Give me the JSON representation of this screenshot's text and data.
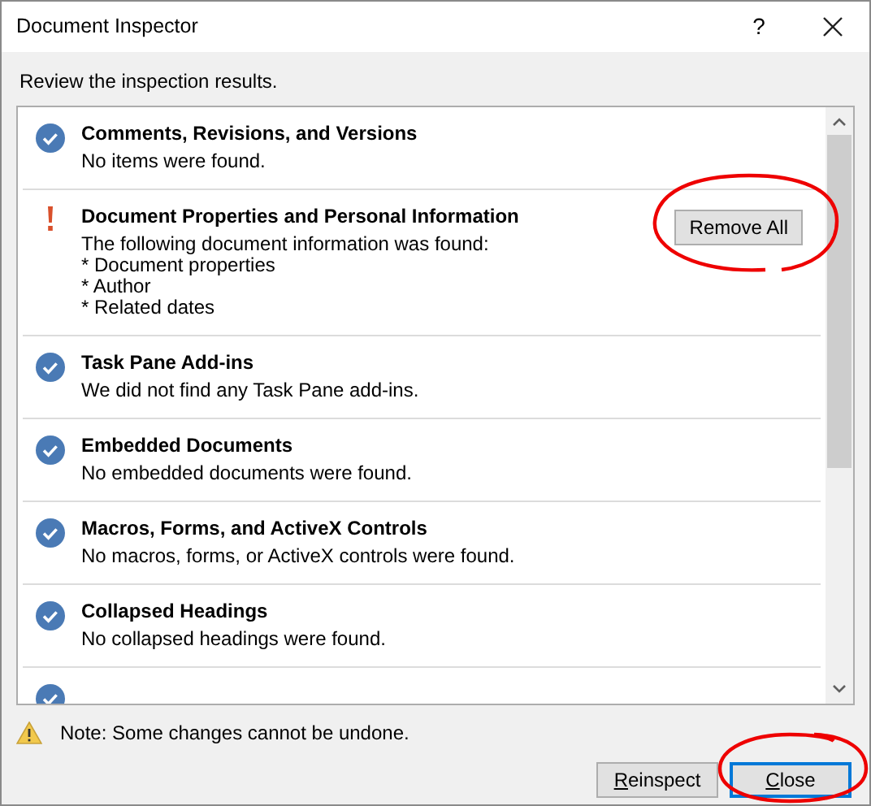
{
  "window": {
    "title": "Document Inspector",
    "help": "?"
  },
  "instruction": "Review the inspection results.",
  "results": [
    {
      "kind": "ok",
      "title": "Comments, Revisions, and Versions",
      "lines": [
        "No items were found."
      ]
    },
    {
      "kind": "warning",
      "title": "Document Properties and Personal Information",
      "lines": [
        "The following document information was found:",
        "* Document properties",
        "* Author",
        "* Related dates"
      ],
      "action": "Remove All"
    },
    {
      "kind": "ok",
      "title": "Task Pane Add-ins",
      "lines": [
        "We did not find any Task Pane add-ins."
      ]
    },
    {
      "kind": "ok",
      "title": "Embedded Documents",
      "lines": [
        "No embedded documents were found."
      ]
    },
    {
      "kind": "ok",
      "title": "Macros, Forms, and ActiveX Controls",
      "lines": [
        "No macros, forms, or ActiveX controls were found."
      ]
    },
    {
      "kind": "ok",
      "title": "Collapsed Headings",
      "lines": [
        "No collapsed headings were found."
      ]
    },
    {
      "kind": "ok"
    }
  ],
  "note": "Note: Some changes cannot be undone.",
  "buttons": [
    {
      "label": "Reinspect",
      "selected": false
    },
    {
      "label": "Close",
      "selected": true
    }
  ]
}
